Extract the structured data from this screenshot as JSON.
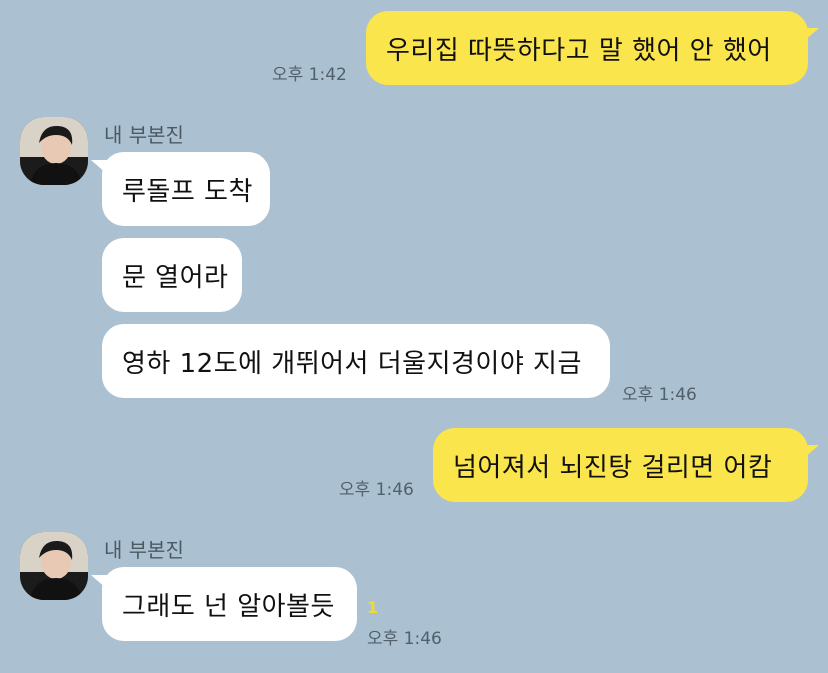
{
  "sender": {
    "name": "내 부본진"
  },
  "messages": [
    {
      "side": "me",
      "text": "우리집 따뜻하다고 말 했어 안 했어",
      "time": "오후 1:42"
    },
    {
      "side": "them",
      "text": "루돌프 도착"
    },
    {
      "side": "them",
      "text": "문 열어라"
    },
    {
      "side": "them",
      "text": "영하 12도에 개뛰어서 더울지경이야 지금",
      "time": "오후 1:46"
    },
    {
      "side": "me",
      "text": "넘어져서 뇌진탕 걸리면 어캄",
      "time": "오후 1:46"
    },
    {
      "side": "them",
      "text": "그래도 넌 알아볼듯",
      "time": "오후 1:46",
      "unread": "1"
    }
  ],
  "colors": {
    "background": "#abc1d1",
    "my_bubble": "#fbe54d",
    "their_bubble": "#ffffff",
    "unread_count": "#f2d92f"
  },
  "icons": {
    "avatar": "profile-photo"
  }
}
